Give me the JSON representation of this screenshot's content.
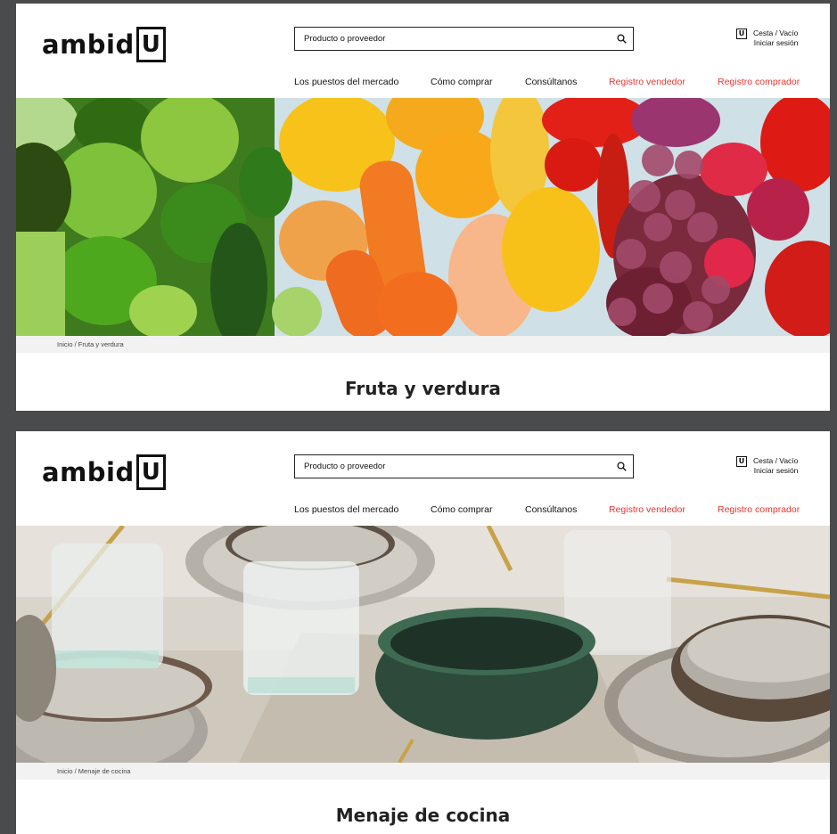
{
  "brand": {
    "logo_text": "ambid",
    "logo_box": "U"
  },
  "search": {
    "placeholder": "Producto o proveedor"
  },
  "basket": {
    "icon_letter": "U",
    "status": "Cesta / Vacío",
    "login": "Iniciar sesión"
  },
  "nav": [
    {
      "label": "Los puestos del mercado"
    },
    {
      "label": "Cómo comprar"
    },
    {
      "label": "Consúltanos"
    },
    {
      "label": "Registro vendedor"
    },
    {
      "label": "Registro comprador"
    }
  ],
  "colors": {
    "accent": "#e8342f",
    "frame": "#4a4b4d",
    "breadcrumb_bg": "#f2f2f2"
  },
  "pages": [
    {
      "breadcrumb_home": "Inicio",
      "breadcrumb_current": "Fruta y verdura",
      "title": "Fruta y verdura"
    },
    {
      "breadcrumb_home": "Inicio",
      "breadcrumb_current": "Menaje de cocina",
      "title": "Menaje de cocina"
    }
  ]
}
